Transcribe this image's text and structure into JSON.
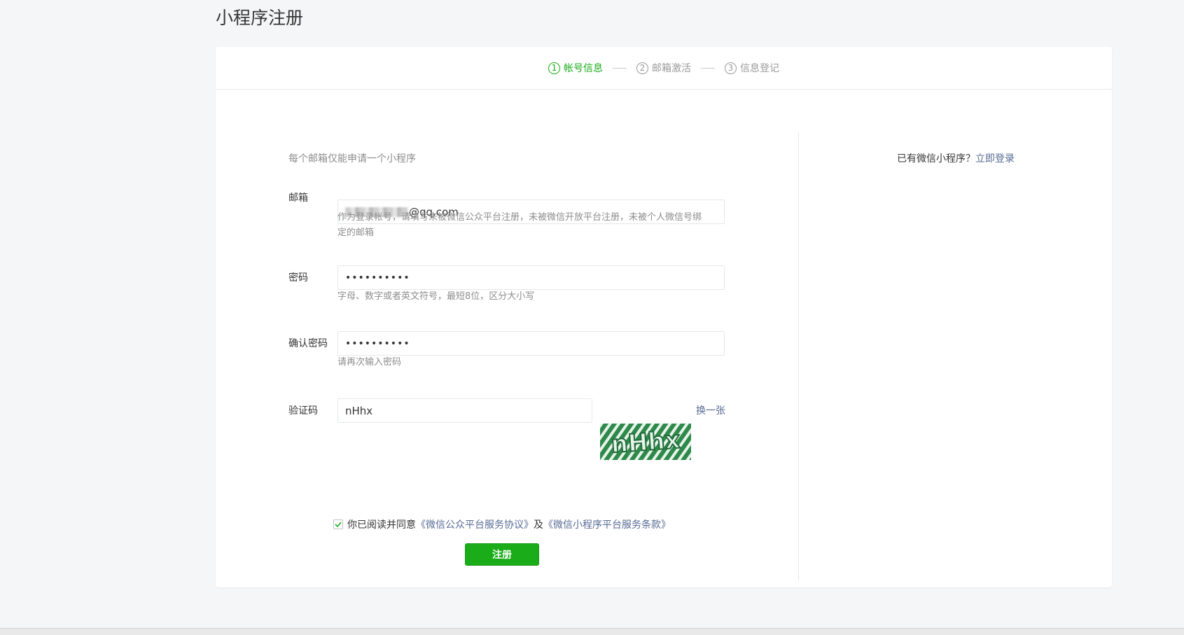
{
  "page": {
    "title": "小程序注册"
  },
  "steps": [
    {
      "num": "1",
      "label": "帐号信息",
      "active": true
    },
    {
      "num": "2",
      "label": "邮箱激活",
      "active": false
    },
    {
      "num": "3",
      "label": "信息登记",
      "active": false
    }
  ],
  "intro": "每个邮箱仅能申请一个小程序",
  "login_hint": {
    "text": "已有微信小程序？",
    "link": "立即登录"
  },
  "form": {
    "email": {
      "label": "邮箱",
      "value_suffix": "@qq.com",
      "help": "作为登录帐号，请填写未被微信公众平台注册，未被微信开放平台注册，未被个人微信号绑定的邮箱"
    },
    "password": {
      "label": "密码",
      "value": "••••••••••",
      "help": "字母、数字或者英文符号，最短8位，区分大小写"
    },
    "confirm": {
      "label": "确认密码",
      "value": "••••••••••",
      "help": "请再次输入密码"
    },
    "captcha": {
      "label": "验证码",
      "value": "nHhx",
      "image_text": "nHhx",
      "refresh": "换一张"
    }
  },
  "terms": {
    "prefix": "你已阅读并同意",
    "link1": "《微信公众平台服务协议》",
    "and": "及",
    "link2": "《微信小程序平台服务条款》",
    "checked": true
  },
  "submit_label": "注册",
  "colors": {
    "accent": "#1aad19",
    "link": "#576b95"
  }
}
